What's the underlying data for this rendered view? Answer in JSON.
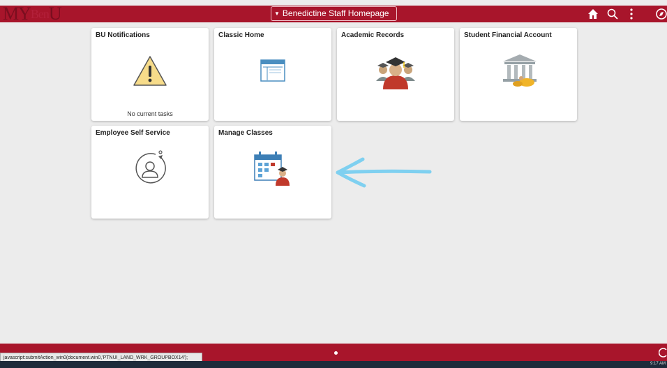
{
  "header": {
    "logo": {
      "my": "MY",
      "ben": "Ben",
      "u": "U"
    },
    "homepage_selector": "Benedictine Staff Homepage",
    "icons": [
      "home-icon",
      "search-icon",
      "actions-menu-icon",
      "navbar-icon"
    ]
  },
  "tiles": [
    {
      "title": "BU Notifications",
      "status": "No current tasks",
      "icon": "warning-icon"
    },
    {
      "title": "Classic Home",
      "icon": "browser-window-icon"
    },
    {
      "title": "Academic Records",
      "icon": "graduate-icon"
    },
    {
      "title": "Student Financial Account",
      "icon": "bank-icon"
    },
    {
      "title": "Employee Self Service",
      "icon": "user-circle-icon"
    },
    {
      "title": "Manage Classes",
      "icon": "calendar-instructor-icon"
    }
  ],
  "annotation": {
    "icon": "arrow-left-annotation",
    "color": "#7fd0f0"
  },
  "footer": {
    "status_url": "javascript:submitAction_win0(document.win0,'PTNUI_LAND_WRK_GROUPBOX14');"
  },
  "taskbar": {
    "clock": "9:17 AM"
  },
  "colors": {
    "brand": "#a8152b",
    "background": "#ececec",
    "tile": "#ffffff"
  }
}
